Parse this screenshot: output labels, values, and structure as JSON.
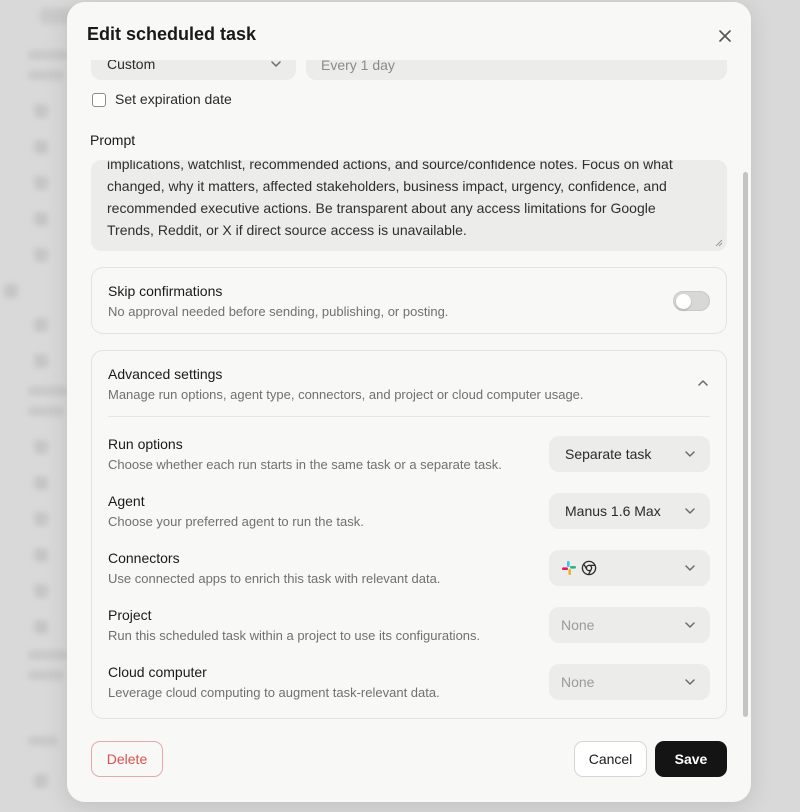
{
  "modal": {
    "title": "Edit scheduled task"
  },
  "schedule": {
    "frequency_value": "Custom",
    "interval_value": "Every 1 day"
  },
  "expiration": {
    "label": "Set expiration date",
    "checked": false
  },
  "prompt": {
    "label": "Prompt",
    "lines": [
      "implications, watchlist, recommended actions, and source/confidence notes. Focus on what",
      "changed, why it matters, affected stakeholders, business impact, urgency, confidence, and",
      "recommended executive actions. Be transparent about any access limitations for Google",
      "Trends, Reddit, or X if direct source access is unavailable."
    ]
  },
  "skip_confirmations": {
    "title": "Skip confirmations",
    "description": "No approval needed before sending, publishing, or posting.",
    "enabled": false
  },
  "advanced": {
    "title": "Advanced settings",
    "description": "Manage run options, agent type, connectors, and project or cloud computer usage.",
    "expanded": true,
    "rows": {
      "run_options": {
        "title": "Run options",
        "description": "Choose whether each run starts in the same task or a separate task.",
        "value": "Separate task"
      },
      "agent": {
        "title": "Agent",
        "description": "Choose your preferred agent to run the task.",
        "value": "Manus 1.6 Max"
      },
      "connectors": {
        "title": "Connectors",
        "description": "Use connected apps to enrich this task with relevant data.",
        "icons": [
          "slack-icon",
          "chrome-icon"
        ]
      },
      "project": {
        "title": "Project",
        "description": "Run this scheduled task within a project to use its configurations.",
        "value": "None"
      },
      "cloud_computer": {
        "title": "Cloud computer",
        "description": "Leverage cloud computing to augment task-relevant data.",
        "value": "None"
      }
    }
  },
  "footer": {
    "delete_label": "Delete",
    "cancel_label": "Cancel",
    "save_label": "Save"
  },
  "colors": {
    "delete_text": "#d9534f",
    "save_bg": "#141414",
    "modal_bg": "#f8f8f7"
  }
}
